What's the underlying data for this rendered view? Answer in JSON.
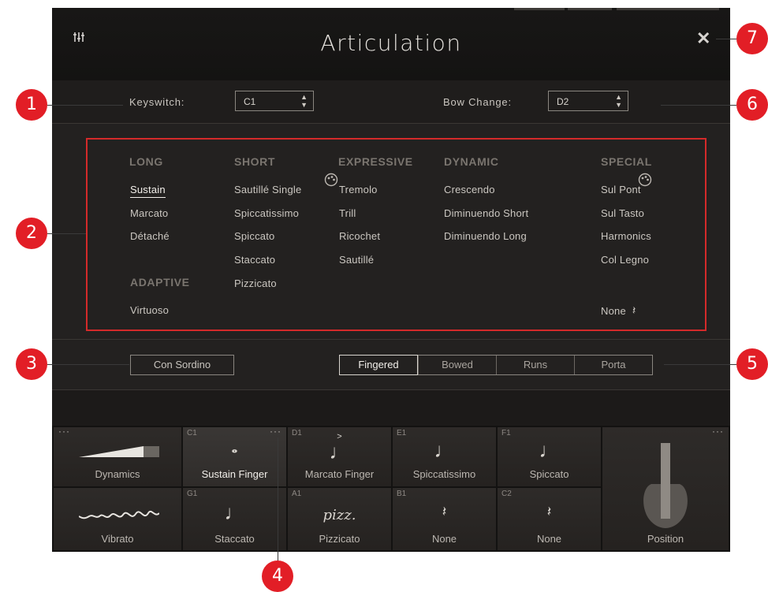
{
  "header": {
    "title": "Articulation"
  },
  "keyswitch": {
    "label": "Keyswitch:",
    "value": "C1"
  },
  "bow_change": {
    "label": "Bow Change:",
    "value": "D2"
  },
  "categories": {
    "long": {
      "title": "LONG",
      "items": [
        "Sustain",
        "Marcato",
        "Détaché"
      ]
    },
    "short": {
      "title": "SHORT",
      "items": [
        "Sautillé Single",
        "Spiccatissimo",
        "Spiccato",
        "Staccato",
        "Pizzicato"
      ]
    },
    "expressive": {
      "title": "EXPRESSIVE",
      "items": [
        "Tremolo",
        "Trill",
        "Ricochet",
        "Sautillé"
      ]
    },
    "dynamic": {
      "title": "DYNAMIC",
      "items": [
        "Crescendo",
        "Diminuendo Short",
        "Diminuendo Long"
      ]
    },
    "special": {
      "title": "SPECIAL",
      "items": [
        "Sul Pont",
        "Sul Tasto",
        "Harmonics",
        "Col Legno"
      ]
    },
    "adaptive": {
      "title": "ADAPTIVE",
      "items": [
        "Virtuoso"
      ]
    },
    "none_label": "None"
  },
  "con_sordino": "Con Sordino",
  "modes": [
    "Fingered",
    "Bowed",
    "Runs",
    "Porta"
  ],
  "slots": {
    "dynamics": "Dynamics",
    "vibrato": "Vibrato",
    "position": "Position",
    "cells": [
      {
        "key": "C1",
        "label": "Sustain Finger"
      },
      {
        "key": "D1",
        "label": "Marcato Finger"
      },
      {
        "key": "E1",
        "label": "Spiccatissimo"
      },
      {
        "key": "F1",
        "label": "Spiccato"
      },
      {
        "key": "G1",
        "label": "Staccato"
      },
      {
        "key": "A1",
        "label": "Pizzicato",
        "glyph": "pizz."
      },
      {
        "key": "B1",
        "label": "None"
      },
      {
        "key": "C2",
        "label": "None"
      }
    ]
  },
  "callouts": [
    "1",
    "2",
    "3",
    "4",
    "5",
    "6",
    "7"
  ]
}
